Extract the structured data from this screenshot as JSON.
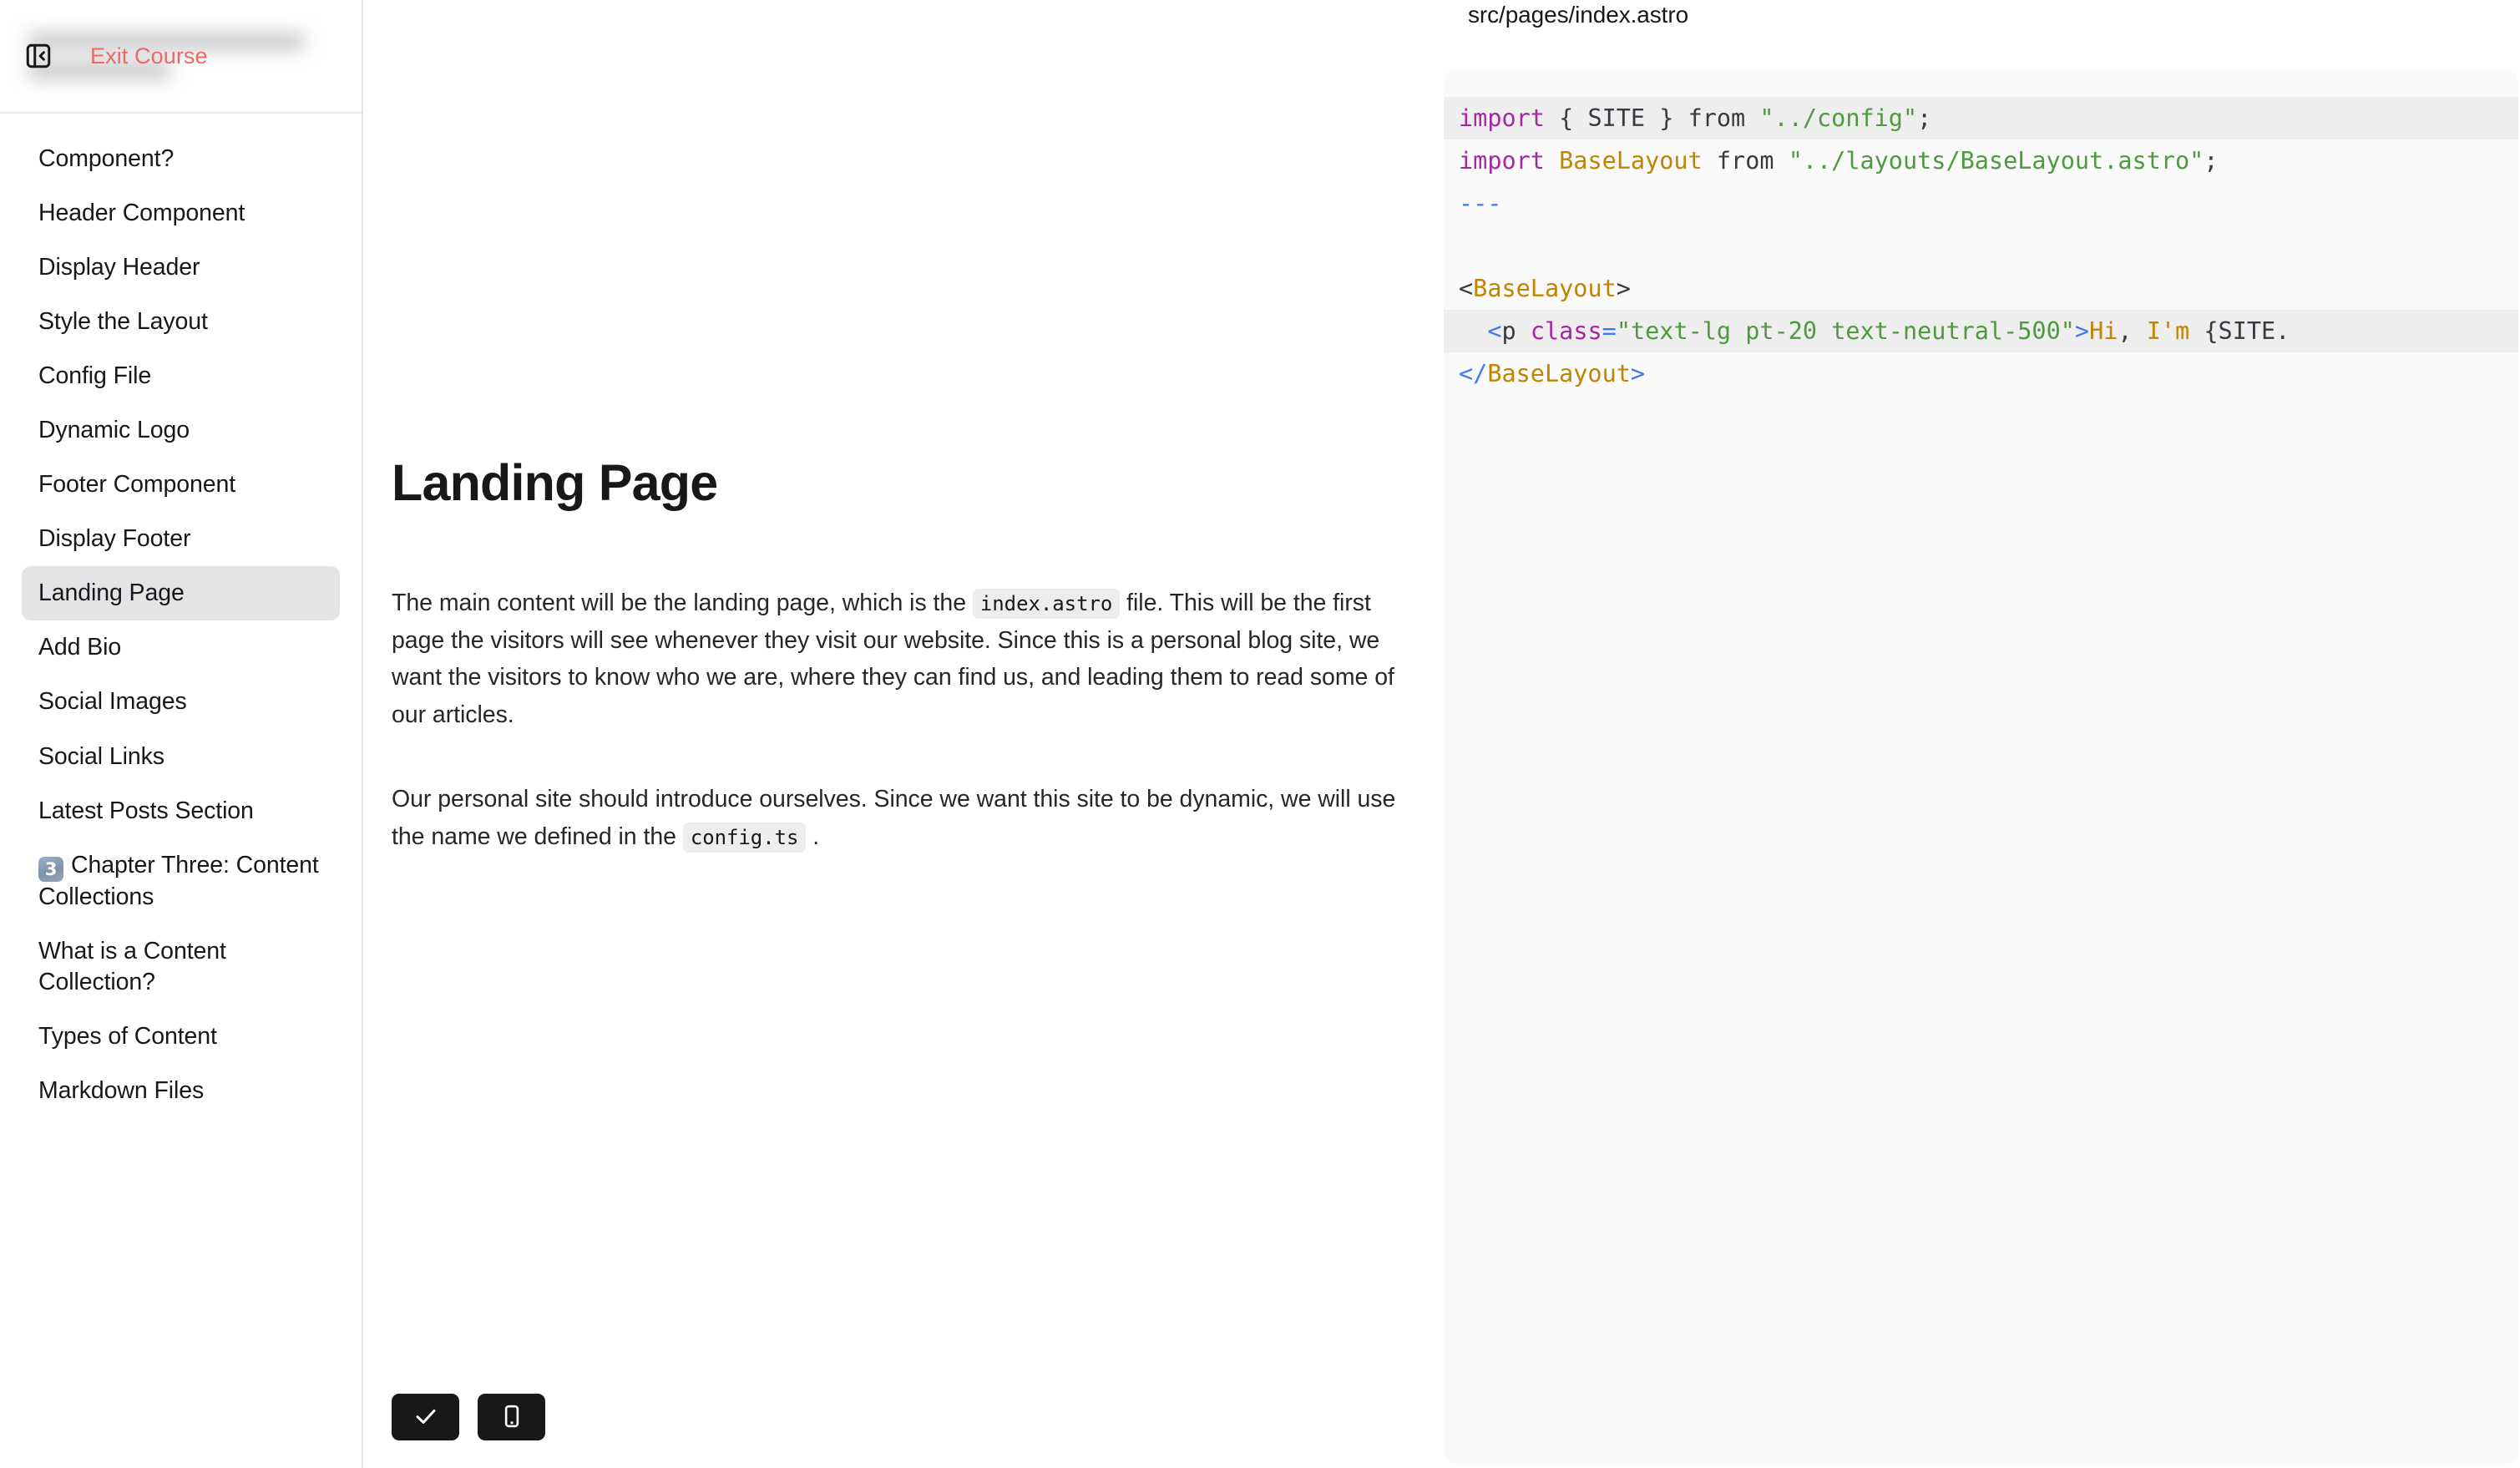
{
  "sidebar": {
    "course_title_blurred": true,
    "exit_label": "Exit Course",
    "collapse_icon": "panel-collapse-icon",
    "items": [
      {
        "label": "Component?",
        "active": false
      },
      {
        "label": "Header Component",
        "active": false
      },
      {
        "label": "Display Header",
        "active": false
      },
      {
        "label": "Style the Layout",
        "active": false
      },
      {
        "label": "Config File",
        "active": false
      },
      {
        "label": "Dynamic Logo",
        "active": false
      },
      {
        "label": "Footer Component",
        "active": false
      },
      {
        "label": "Display Footer",
        "active": false
      },
      {
        "label": "Landing Page",
        "active": true
      },
      {
        "label": "Add Bio",
        "active": false
      },
      {
        "label": "Social Images",
        "active": false
      },
      {
        "label": "Social Links",
        "active": false
      },
      {
        "label": "Latest Posts Section",
        "active": false
      },
      {
        "label": "Chapter Three: Content Collections",
        "active": false,
        "keycap": "3"
      },
      {
        "label": "What is a Content Collection?",
        "active": false
      },
      {
        "label": "Types of Content",
        "active": false
      },
      {
        "label": "Markdown Files",
        "active": false
      }
    ]
  },
  "main": {
    "title": "Landing Page",
    "paragraph1_a": "The main content will be the landing page, which is the",
    "paragraph1_code": "index.astro",
    "paragraph1_b": "file. This will be the first page the visitors will see whenever they visit our website. Since this is a personal blog site, we want the visitors to know who we are, where they can find us, and leading them to read some of our articles.",
    "paragraph2_a": "Our personal site should introduce ourselves. Since we want this site to be dynamic, we will use the name we defined in the",
    "paragraph2_code": "config.ts",
    "paragraph2_b": ".",
    "actions": [
      {
        "name": "mark-complete-button",
        "icon": "check-icon"
      },
      {
        "name": "mobile-preview-button",
        "icon": "smartphone-icon"
      }
    ]
  },
  "code_panel": {
    "filename": "src/pages/index.astro",
    "lines": [
      {
        "highlight": true,
        "tokens": [
          {
            "t": "import",
            "c": "kw"
          },
          {
            "t": " { ",
            "c": "punc"
          },
          {
            "t": "SITE",
            "c": "txt"
          },
          {
            "t": " } ",
            "c": "punc"
          },
          {
            "t": "from",
            "c": "txt"
          },
          {
            "t": " ",
            "c": "punc"
          },
          {
            "t": "\"../config\"",
            "c": "str"
          },
          {
            "t": ";",
            "c": "punc"
          }
        ]
      },
      {
        "highlight": false,
        "tokens": [
          {
            "t": "import",
            "c": "kw"
          },
          {
            "t": " ",
            "c": "punc"
          },
          {
            "t": "BaseLayout",
            "c": "cls"
          },
          {
            "t": " ",
            "c": "punc"
          },
          {
            "t": "from",
            "c": "txt"
          },
          {
            "t": " ",
            "c": "punc"
          },
          {
            "t": "\"../layouts/BaseLayout.astro\"",
            "c": "str"
          },
          {
            "t": ";",
            "c": "punc"
          }
        ]
      },
      {
        "highlight": false,
        "tokens": [
          {
            "t": "---",
            "c": "dash"
          }
        ]
      },
      {
        "highlight": false,
        "tokens": [
          {
            "t": "",
            "c": "punc"
          }
        ]
      },
      {
        "highlight": false,
        "tokens": [
          {
            "t": "<",
            "c": "punc"
          },
          {
            "t": "BaseLayout",
            "c": "tag"
          },
          {
            "t": ">",
            "c": "punc"
          }
        ]
      },
      {
        "highlight": true,
        "tokens": [
          {
            "t": "  ",
            "c": "punc"
          },
          {
            "t": "<",
            "c": "br"
          },
          {
            "t": "p",
            "c": "txt"
          },
          {
            "t": " ",
            "c": "punc"
          },
          {
            "t": "class",
            "c": "attr"
          },
          {
            "t": "=",
            "c": "br"
          },
          {
            "t": "\"text-lg pt-20 text-neutral-500\"",
            "c": "str"
          },
          {
            "t": ">",
            "c": "br"
          },
          {
            "t": "Hi",
            "c": "cls"
          },
          {
            "t": ", ",
            "c": "txt"
          },
          {
            "t": "I'm",
            "c": "cls"
          },
          {
            "t": " ",
            "c": "txt"
          },
          {
            "t": "{SITE.",
            "c": "txt"
          }
        ]
      },
      {
        "highlight": false,
        "tokens": [
          {
            "t": "</",
            "c": "br"
          },
          {
            "t": "BaseLayout",
            "c": "tag"
          },
          {
            "t": ">",
            "c": "br"
          }
        ]
      }
    ]
  },
  "colors": {
    "accent_exit": "#ec6a64",
    "active_nav_bg": "#e4e4e7",
    "code_bg": "#fafafa",
    "code_highlight": "#eeeeee",
    "button_bg": "#18181b"
  }
}
